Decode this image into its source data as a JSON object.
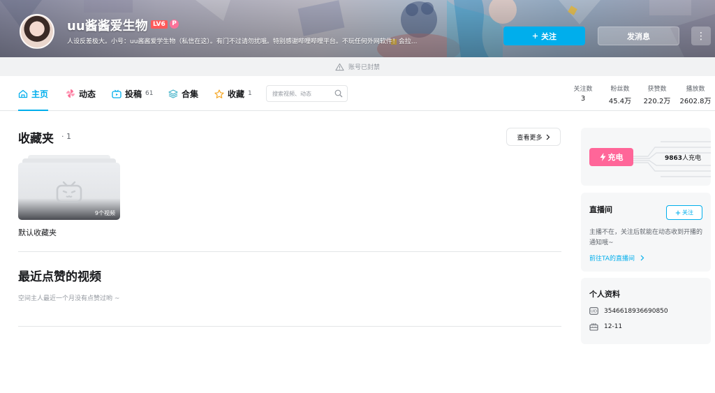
{
  "header": {
    "username": "uu酱酱爱生物",
    "level": "LV6",
    "badge": "P",
    "signature": "人设反差极大。小号：uu酱酱爱学生物（私信在这）。有门不过请勿扰哦。特别感谢哔哩哔哩平台。不玩任何外网软件！会拉...",
    "follow_label": "关注",
    "message_label": "发消息",
    "more_label": "⋮"
  },
  "notice": {
    "banned_text": "账号已封禁"
  },
  "nav": {
    "tabs": [
      {
        "label": "主页",
        "count": ""
      },
      {
        "label": "动态",
        "count": ""
      },
      {
        "label": "投稿",
        "count": "61"
      },
      {
        "label": "合集",
        "count": ""
      },
      {
        "label": "收藏",
        "count": "1"
      }
    ],
    "search_placeholder": "搜索视频、动态"
  },
  "stats": [
    {
      "label": "关注数",
      "value": "3"
    },
    {
      "label": "粉丝数",
      "value": "45.4万"
    },
    {
      "label": "获赞数",
      "value": "220.2万"
    },
    {
      "label": "播放数",
      "value": "2602.8万"
    }
  ],
  "favorites": {
    "title": "收藏夹",
    "count": "1",
    "more_label": "查看更多",
    "folder": {
      "name": "默认收藏夹",
      "video_count": "9个视频"
    }
  },
  "likes": {
    "title": "最近点赞的视频",
    "empty_text": "空间主人最近一个月没有点赞过哟 ~"
  },
  "sidebar": {
    "charge": {
      "label": "充电",
      "count": "9863",
      "suffix": "人充电"
    },
    "live": {
      "title": "直播间",
      "follow_label": "关注",
      "desc": "主播不在，关注后就能在动态收到开播的通知哦~",
      "link": "前往TA的直播间"
    },
    "profile": {
      "title": "个人资料",
      "uid": "3546618936690850",
      "birthday": "12-11"
    }
  },
  "colors": {
    "accent": "#00aeec",
    "pink": "#ff6699",
    "level": "#ff5a5a"
  }
}
